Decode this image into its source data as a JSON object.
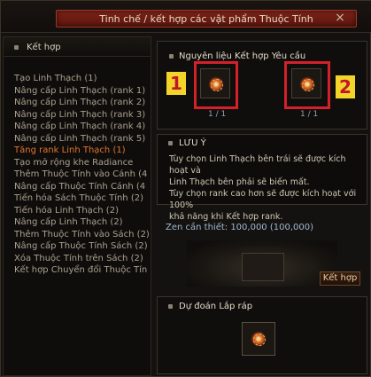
{
  "window": {
    "title": "Tinh chế / kết hợp các vật phẩm Thuộc Tính",
    "close_glyph": "×"
  },
  "left": {
    "header": "Kết hợp",
    "items": [
      {
        "label": "Tạo Linh Thạch (1)",
        "active": false
      },
      {
        "label": "Nâng cấp Linh Thạch (rank 1)",
        "active": false
      },
      {
        "label": "Nâng cấp Linh Thạch (rank 2)",
        "active": false
      },
      {
        "label": "Nâng cấp Linh Thạch (rank 3)",
        "active": false
      },
      {
        "label": "Nâng cấp Linh Thạch (rank 4)",
        "active": false
      },
      {
        "label": "Nâng cấp Linh Thạch (rank 5)",
        "active": false
      },
      {
        "label": "Tăng rank Linh Thạch (1)",
        "active": true
      },
      {
        "label": "Tạo mở rộng khe Radiance",
        "active": false
      },
      {
        "label": "Thêm Thuộc Tính vào Cánh (4",
        "active": false
      },
      {
        "label": "Nâng cấp Thuộc Tính Cánh (4",
        "active": false
      },
      {
        "label": "Tiến hóa Sách Thuộc Tính (2)",
        "active": false
      },
      {
        "label": "Tiến hóa Linh Thạch (2)",
        "active": false
      },
      {
        "label": "Nâng cấp Linh Thạch (2)",
        "active": false
      },
      {
        "label": "Thêm Thuộc Tính vào Sách (2)",
        "active": false
      },
      {
        "label": "Nâng cấp Thuộc Tính Sách (2)",
        "active": false
      },
      {
        "label": "Xóa Thuộc Tính trên Sách (2)",
        "active": false
      },
      {
        "label": "Kết hợp Chuyển đổi Thuộc Tín",
        "active": false
      }
    ]
  },
  "materials": {
    "title": "Nguyên liệu Kết hợp Yêu cầu",
    "slots": [
      {
        "count": "1 / 1",
        "marker": "1"
      },
      {
        "count": "1 / 1",
        "marker": "2"
      }
    ],
    "icon": "elemental-gem-icon",
    "highlight_color": "#d4202a",
    "marker_color": "#f3d428"
  },
  "note": {
    "title": "LƯU Ý",
    "lines": [
      "Tùy chọn Linh Thạch bên trái sẽ được kích hoạt và",
      "Linh Thạch bên phải sẽ biến mất.",
      "Tùy chọn rank cao hơn sẽ được kích hoạt với 100%",
      "khả năng khi Kết hợp rank."
    ]
  },
  "zen": {
    "text": "Zen cần thiết: 100,000 (100,000)"
  },
  "combine_button": {
    "label": "Kết hợp"
  },
  "predict": {
    "title": "Dự đoán Lắp ráp",
    "icon": "elemental-gem-icon"
  },
  "colors": {
    "accent_active": "#e0752f",
    "title_plate": "#7e2418",
    "zen_text": "#9fb8d0"
  }
}
